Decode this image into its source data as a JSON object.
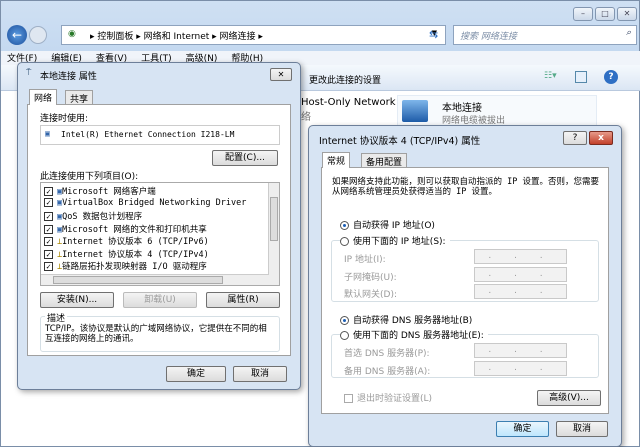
{
  "explorer": {
    "breadcrumb": [
      "控制面板",
      "网络和 Internet",
      "网络连接"
    ],
    "search_placeholder": "搜索 网络连接",
    "menu": [
      "文件(F)",
      "编辑(E)",
      "查看(V)",
      "工具(T)",
      "高级(N)",
      "帮助(H)"
    ],
    "toolbar_action": "更改此连接的设置",
    "items": [
      {
        "name": "Host-Only Network",
        "status": "络"
      },
      {
        "name": "本地连接",
        "status": "网络电缆被拔出"
      }
    ]
  },
  "props": {
    "title": "本地连接 属性",
    "tabs": [
      "网络",
      "共享"
    ],
    "connect_using_label": "连接时使用:",
    "adapter": "Intel(R) Ethernet Connection I218-LM",
    "configure": "配置(C)...",
    "items_label": "此连接使用下列项目(O):",
    "items": [
      "Microsoft 网络客户端",
      "VirtualBox Bridged Networking Driver",
      "QoS 数据包计划程序",
      "Microsoft 网络的文件和打印机共享",
      "Internet 协议版本 6 (TCP/IPv6)",
      "Internet 协议版本 4 (TCP/IPv4)",
      "链路层拓扑发现映射器 I/O 驱动程序"
    ],
    "install": "安装(N)...",
    "uninstall": "卸载(U)",
    "properties": "属性(R)",
    "desc_label": "描述",
    "desc": "TCP/IP。该协议是默认的广域网络协议，它提供在不同的相互连接的网络上的通讯。",
    "ok": "确定",
    "cancel": "取消"
  },
  "ipv4": {
    "title": "Internet 协议版本 4 (TCP/IPv4) 属性",
    "help": "?",
    "close": "x",
    "tabs": [
      "常规",
      "备用配置"
    ],
    "intro": "如果网络支持此功能，则可以获取自动指派的 IP 设置。否则，您需要从网络系统管理员处获得适当的 IP 设置。",
    "auto_ip": "自动获得 IP 地址(O)",
    "manual_ip": "使用下面的 IP 地址(S):",
    "ip_label": "IP 地址(I):",
    "mask_label": "子网掩码(U):",
    "gw_label": "默认网关(D):",
    "auto_dns": "自动获得 DNS 服务器地址(B)",
    "manual_dns": "使用下面的 DNS 服务器地址(E):",
    "dns1_label": "首选 DNS 服务器(P):",
    "dns2_label": "备用 DNS 服务器(A):",
    "ip_placeholder": ". . .",
    "validate": "退出时验证设置(L)",
    "advanced": "高级(V)...",
    "ok": "确定",
    "cancel": "取消"
  }
}
